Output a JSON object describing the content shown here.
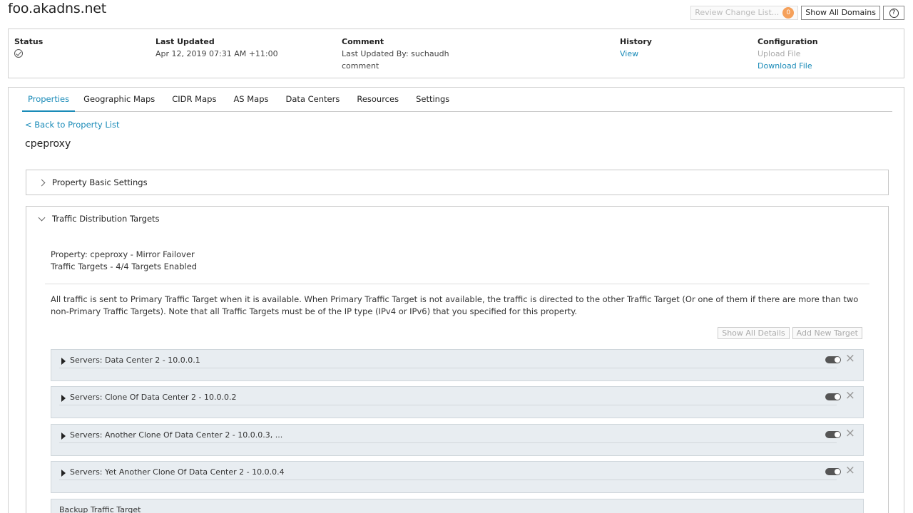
{
  "header": {
    "domain": "foo.akadns.net",
    "review_label": "Review Change List...",
    "review_count": "0",
    "show_all_domains": "Show All Domains",
    "help": "?"
  },
  "summary": {
    "status": {
      "head": "Status",
      "icon": "check-circle-icon"
    },
    "last_updated": {
      "head": "Last Updated",
      "value": "Apr 12, 2019 07:31 AM +11:00"
    },
    "comment": {
      "head": "Comment",
      "by": "Last Updated By: suchaudh",
      "text": "comment"
    },
    "history": {
      "head": "History",
      "link": "View"
    },
    "configuration": {
      "head": "Configuration",
      "upload": "Upload File",
      "download": "Download File"
    }
  },
  "tabs": [
    "Properties",
    "Geographic Maps",
    "CIDR Maps",
    "AS Maps",
    "Data Centers",
    "Resources",
    "Settings"
  ],
  "back_link": "< Back to Property List",
  "property_name": "cpeproxy",
  "basic_settings": {
    "title": "Property Basic Settings"
  },
  "traffic": {
    "title": "Traffic Distribution Targets",
    "property_line": "Property: cpeproxy - Mirror Failover",
    "targets_line": "Traffic Targets - 4/4 Targets Enabled",
    "description": "All traffic is sent to Primary Traffic Target when it is available. When Primary Traffic Target is not available, the traffic is directed to the other Traffic Target (Or one of them if there are more than two non-Primary Traffic Targets). Note that all Traffic Targets must be of the IP type (IPv4 or IPv6) that you specified for this property.",
    "show_all_details": "Show All Details",
    "add_new_target": "Add New Target",
    "targets": [
      {
        "label": "Servers: Data Center 2 - 10.0.0.1",
        "enabled": true
      },
      {
        "label": "Servers: Clone Of Data Center 2 - 10.0.0.2",
        "enabled": true
      },
      {
        "label": "Servers: Another Clone Of Data Center 2 - 10.0.0.3, ...",
        "enabled": true
      },
      {
        "label": "Servers: Yet Another Clone Of Data Center 2 - 10.0.0.4",
        "enabled": true
      }
    ],
    "backup_label": "Backup Traffic Target"
  }
}
